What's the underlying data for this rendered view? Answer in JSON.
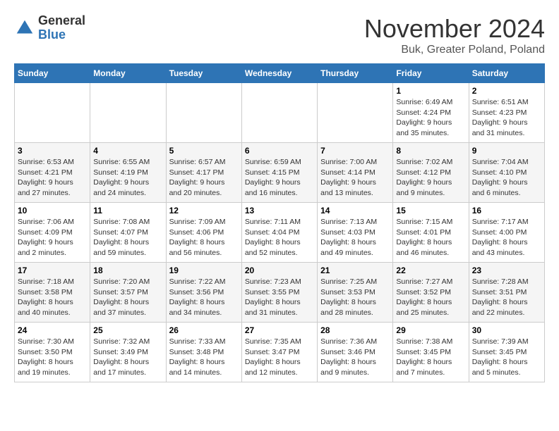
{
  "logo": {
    "general": "General",
    "blue": "Blue"
  },
  "title": "November 2024",
  "location": "Buk, Greater Poland, Poland",
  "days_of_week": [
    "Sunday",
    "Monday",
    "Tuesday",
    "Wednesday",
    "Thursday",
    "Friday",
    "Saturday"
  ],
  "weeks": [
    [
      {
        "day": "",
        "info": ""
      },
      {
        "day": "",
        "info": ""
      },
      {
        "day": "",
        "info": ""
      },
      {
        "day": "",
        "info": ""
      },
      {
        "day": "",
        "info": ""
      },
      {
        "day": "1",
        "info": "Sunrise: 6:49 AM\nSunset: 4:24 PM\nDaylight: 9 hours and 35 minutes."
      },
      {
        "day": "2",
        "info": "Sunrise: 6:51 AM\nSunset: 4:23 PM\nDaylight: 9 hours and 31 minutes."
      }
    ],
    [
      {
        "day": "3",
        "info": "Sunrise: 6:53 AM\nSunset: 4:21 PM\nDaylight: 9 hours and 27 minutes."
      },
      {
        "day": "4",
        "info": "Sunrise: 6:55 AM\nSunset: 4:19 PM\nDaylight: 9 hours and 24 minutes."
      },
      {
        "day": "5",
        "info": "Sunrise: 6:57 AM\nSunset: 4:17 PM\nDaylight: 9 hours and 20 minutes."
      },
      {
        "day": "6",
        "info": "Sunrise: 6:59 AM\nSunset: 4:15 PM\nDaylight: 9 hours and 16 minutes."
      },
      {
        "day": "7",
        "info": "Sunrise: 7:00 AM\nSunset: 4:14 PM\nDaylight: 9 hours and 13 minutes."
      },
      {
        "day": "8",
        "info": "Sunrise: 7:02 AM\nSunset: 4:12 PM\nDaylight: 9 hours and 9 minutes."
      },
      {
        "day": "9",
        "info": "Sunrise: 7:04 AM\nSunset: 4:10 PM\nDaylight: 9 hours and 6 minutes."
      }
    ],
    [
      {
        "day": "10",
        "info": "Sunrise: 7:06 AM\nSunset: 4:09 PM\nDaylight: 9 hours and 2 minutes."
      },
      {
        "day": "11",
        "info": "Sunrise: 7:08 AM\nSunset: 4:07 PM\nDaylight: 8 hours and 59 minutes."
      },
      {
        "day": "12",
        "info": "Sunrise: 7:09 AM\nSunset: 4:06 PM\nDaylight: 8 hours and 56 minutes."
      },
      {
        "day": "13",
        "info": "Sunrise: 7:11 AM\nSunset: 4:04 PM\nDaylight: 8 hours and 52 minutes."
      },
      {
        "day": "14",
        "info": "Sunrise: 7:13 AM\nSunset: 4:03 PM\nDaylight: 8 hours and 49 minutes."
      },
      {
        "day": "15",
        "info": "Sunrise: 7:15 AM\nSunset: 4:01 PM\nDaylight: 8 hours and 46 minutes."
      },
      {
        "day": "16",
        "info": "Sunrise: 7:17 AM\nSunset: 4:00 PM\nDaylight: 8 hours and 43 minutes."
      }
    ],
    [
      {
        "day": "17",
        "info": "Sunrise: 7:18 AM\nSunset: 3:58 PM\nDaylight: 8 hours and 40 minutes."
      },
      {
        "day": "18",
        "info": "Sunrise: 7:20 AM\nSunset: 3:57 PM\nDaylight: 8 hours and 37 minutes."
      },
      {
        "day": "19",
        "info": "Sunrise: 7:22 AM\nSunset: 3:56 PM\nDaylight: 8 hours and 34 minutes."
      },
      {
        "day": "20",
        "info": "Sunrise: 7:23 AM\nSunset: 3:55 PM\nDaylight: 8 hours and 31 minutes."
      },
      {
        "day": "21",
        "info": "Sunrise: 7:25 AM\nSunset: 3:53 PM\nDaylight: 8 hours and 28 minutes."
      },
      {
        "day": "22",
        "info": "Sunrise: 7:27 AM\nSunset: 3:52 PM\nDaylight: 8 hours and 25 minutes."
      },
      {
        "day": "23",
        "info": "Sunrise: 7:28 AM\nSunset: 3:51 PM\nDaylight: 8 hours and 22 minutes."
      }
    ],
    [
      {
        "day": "24",
        "info": "Sunrise: 7:30 AM\nSunset: 3:50 PM\nDaylight: 8 hours and 19 minutes."
      },
      {
        "day": "25",
        "info": "Sunrise: 7:32 AM\nSunset: 3:49 PM\nDaylight: 8 hours and 17 minutes."
      },
      {
        "day": "26",
        "info": "Sunrise: 7:33 AM\nSunset: 3:48 PM\nDaylight: 8 hours and 14 minutes."
      },
      {
        "day": "27",
        "info": "Sunrise: 7:35 AM\nSunset: 3:47 PM\nDaylight: 8 hours and 12 minutes."
      },
      {
        "day": "28",
        "info": "Sunrise: 7:36 AM\nSunset: 3:46 PM\nDaylight: 8 hours and 9 minutes."
      },
      {
        "day": "29",
        "info": "Sunrise: 7:38 AM\nSunset: 3:45 PM\nDaylight: 8 hours and 7 minutes."
      },
      {
        "day": "30",
        "info": "Sunrise: 7:39 AM\nSunset: 3:45 PM\nDaylight: 8 hours and 5 minutes."
      }
    ]
  ]
}
